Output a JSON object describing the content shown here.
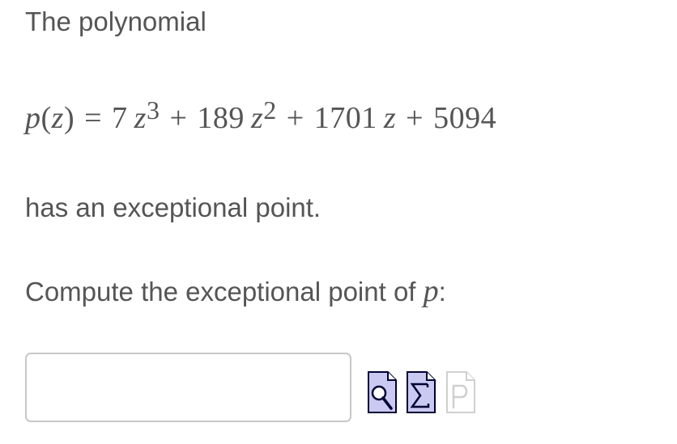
{
  "intro_text": "The polynomial",
  "formula": {
    "lhs_func": "p",
    "lhs_open": "(",
    "lhs_var": "z",
    "lhs_close": ")",
    "equals": "=",
    "t1_coef": "7",
    "t1_var": "z",
    "t1_exp": "3",
    "plus1": "+",
    "t2_coef": "189",
    "t2_var": "z",
    "t2_exp": "2",
    "plus2": "+",
    "t3_coef": "1701",
    "t3_var": "z",
    "plus3": "+",
    "t4_const": "5094"
  },
  "statement_text": "has an exceptional point.",
  "question": {
    "prefix": "Compute the exceptional point of ",
    "var": "p",
    "suffix": ":"
  },
  "answer": {
    "value": "",
    "placeholder": ""
  },
  "tools": {
    "preview_icon": "magnifier-page-icon",
    "equation_icon": "sigma-page-icon",
    "p_icon": "p-page-icon",
    "active_fill": "#c9c9f2",
    "active_stroke": "#000033",
    "disabled_stroke": "#cfcfcf"
  }
}
